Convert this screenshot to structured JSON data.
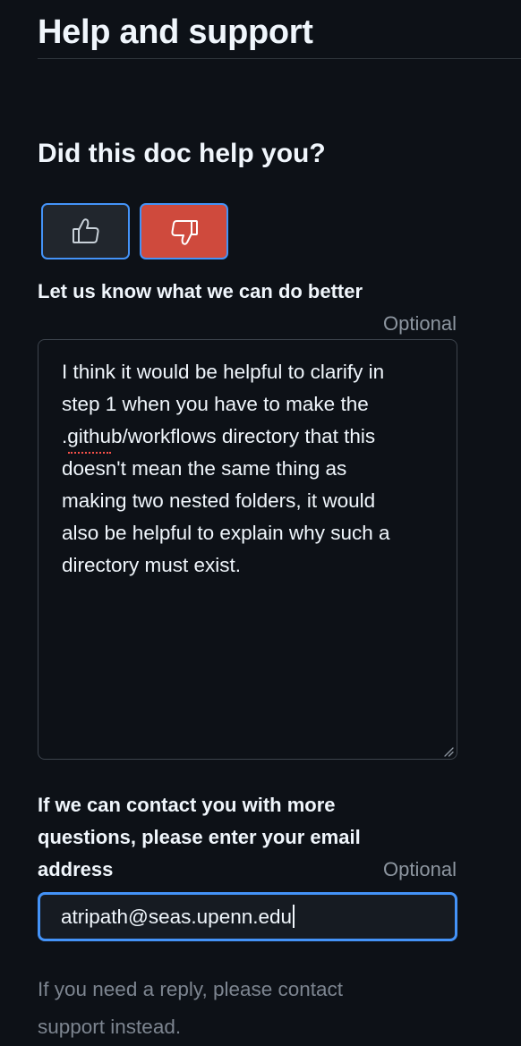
{
  "header": {
    "title": "Help and support"
  },
  "feedback": {
    "heading": "Did this doc help you?",
    "thumbs_up": {
      "icon": "thumbs-up-icon",
      "selected": false
    },
    "thumbs_down": {
      "icon": "thumbs-down-icon",
      "selected": true
    }
  },
  "better_field": {
    "label": "Let us know what we can do better",
    "optional": "Optional",
    "value": "I think it would be helpful to clarify in\nstep 1 when you have to make the\n.github/workflows directory that this\ndoesn't mean the same thing as\nmaking two nested folders, it would\nalso be helpful to explain why such a\ndirectory must exist."
  },
  "contact_field": {
    "label": "If we can contact you with more questions, please enter your email address",
    "optional": "Optional",
    "value": "atripath@seas.upenn.edu"
  },
  "footer": {
    "note": "If you need a reply, please contact support instead."
  },
  "colors": {
    "background": "#0d1117",
    "accent_border": "#4493f8",
    "thumbs_down_active": "#cf4a3d",
    "muted_text": "#7d8590"
  }
}
